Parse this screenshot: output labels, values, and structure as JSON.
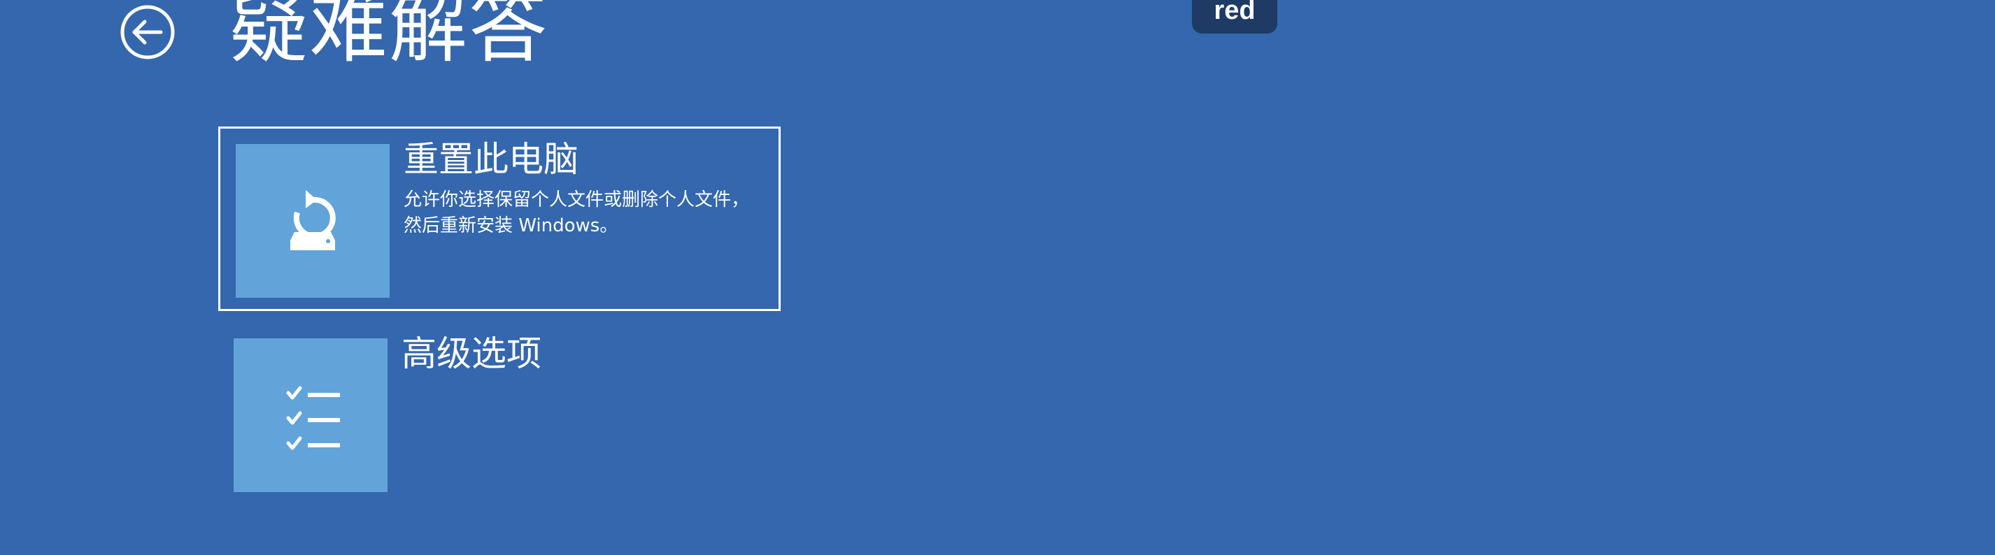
{
  "header": {
    "title": "疑难解答",
    "back_icon": "back-arrow-circle-icon"
  },
  "overlay": {
    "badge_text": "red"
  },
  "options": [
    {
      "title": "重置此电脑",
      "description": "允许你选择保留个人文件或删除个人文件，然后重新安装 Windows。",
      "icon": "reset-pc-icon",
      "selected": true
    },
    {
      "title": "高级选项",
      "description": "",
      "icon": "checklist-icon",
      "selected": false
    }
  ],
  "colors": {
    "background": "#3467ad",
    "tile": "#62a4da",
    "text": "#ffffff",
    "badge": "#1e3b66"
  }
}
